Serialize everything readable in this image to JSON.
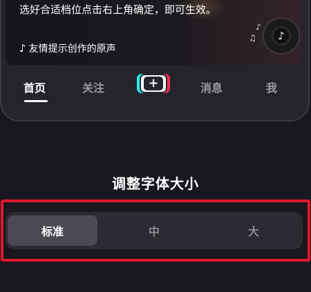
{
  "preview": {
    "caption": "选好合适档位点击右上角确定，即可生效。",
    "music_text": "友情提示创作的原声",
    "note_icon": "music-note-icon",
    "disc_icon": "tiktok-logo-icon"
  },
  "nav": {
    "items": [
      {
        "label": "首页",
        "active": true
      },
      {
        "label": "关注",
        "active": false
      },
      {
        "label": "消息",
        "active": false
      },
      {
        "label": "我",
        "active": false
      }
    ],
    "plus_label": "+"
  },
  "font_size": {
    "title": "调整字体大小",
    "options": [
      {
        "label": "标准",
        "selected": true
      },
      {
        "label": "中",
        "selected": false
      },
      {
        "label": "大",
        "selected": false
      }
    ]
  },
  "colors": {
    "background": "#18181e",
    "highlight_border": "#e0192f",
    "tiktok_cyan": "#25f4ee",
    "tiktok_red": "#fe2c55"
  }
}
